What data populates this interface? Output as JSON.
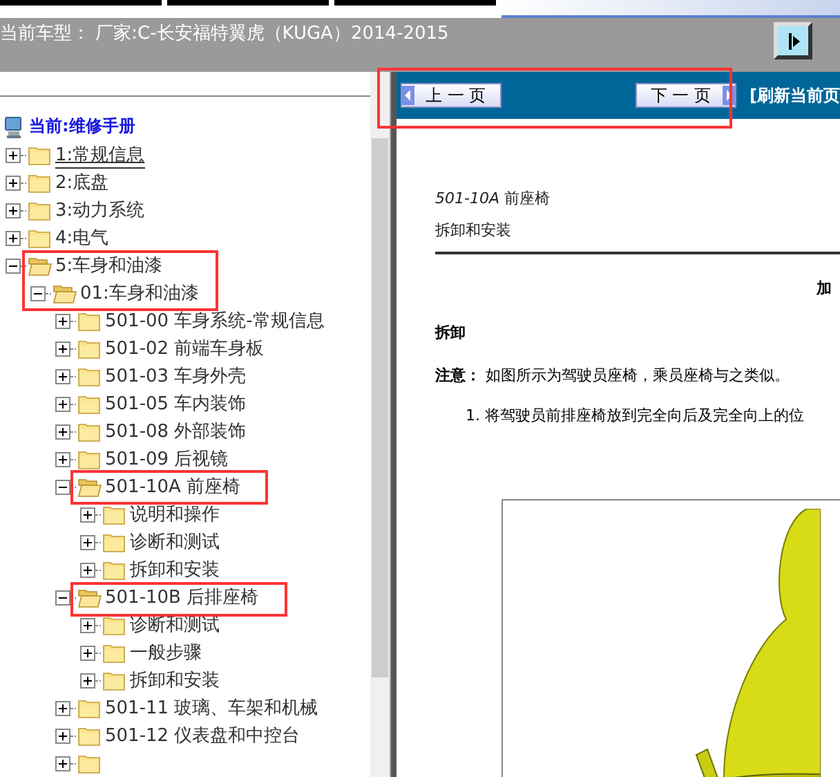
{
  "header": {
    "title": "当前车型： 厂家:C-长安福特翼虎（KUGA）2014-2015"
  },
  "sidebar": {
    "current": "当前:维修手册",
    "tree": [
      {
        "label": "1:常规信息",
        "expanded": false,
        "underlined": true
      },
      {
        "label": "2:底盘",
        "expanded": false,
        "underlined": false
      },
      {
        "label": "3:动力系统",
        "expanded": false,
        "underlined": false
      },
      {
        "label": "4:电气",
        "expanded": false,
        "underlined": false
      },
      {
        "label": "5:车身和油漆",
        "expanded": true,
        "underlined": false,
        "children": [
          {
            "label": "01:车身和油漆",
            "expanded": true,
            "underlined": false,
            "children": [
              {
                "label": "501-00 车身系统-常规信息",
                "expanded": false,
                "underlined": false
              },
              {
                "label": "501-02 前端车身板",
                "expanded": false,
                "underlined": false
              },
              {
                "label": "501-03 车身外壳",
                "expanded": false,
                "underlined": false
              },
              {
                "label": "501-05 车内装饰",
                "expanded": false,
                "underlined": false
              },
              {
                "label": "501-08 外部装饰",
                "expanded": false,
                "underlined": false
              },
              {
                "label": "501-09 后视镜",
                "expanded": false,
                "underlined": false
              },
              {
                "label": "501-10A 前座椅",
                "expanded": true,
                "underlined": false,
                "children": [
                  {
                    "label": "说明和操作",
                    "expanded": false,
                    "underlined": false
                  },
                  {
                    "label": "诊断和测试",
                    "expanded": false,
                    "underlined": false
                  },
                  {
                    "label": "拆卸和安装",
                    "expanded": false,
                    "underlined": false
                  }
                ]
              },
              {
                "label": "501-10B 后排座椅",
                "expanded": true,
                "underlined": false,
                "children": [
                  {
                    "label": "诊断和测试",
                    "expanded": false,
                    "underlined": false
                  },
                  {
                    "label": "一般步骤",
                    "expanded": false,
                    "underlined": false
                  },
                  {
                    "label": "拆卸和安装",
                    "expanded": false,
                    "underlined": false
                  }
                ]
              },
              {
                "label": "501-11 玻璃、车架和机械",
                "expanded": false,
                "underlined": false
              },
              {
                "label": "501-12 仪表盘和中控台",
                "expanded": false,
                "underlined": false
              },
              {
                "expanded": false
              }
            ]
          }
        ]
      }
    ]
  },
  "toolbar": {
    "prev_button": "上 一 页",
    "next_button": "下 一 页",
    "refresh_link": "[刷新当前页"
  },
  "document": {
    "section": "*501-10A* 前座椅",
    "subtitle": "拆卸和安装",
    "side_heading": "加",
    "heading": "拆卸",
    "note": "**注意：** 如图所示为驾驶员座椅，乘员座椅与之类似。",
    "step": "1. 将驾驶员前排座椅放到完全向后及完全向上的位"
  }
}
